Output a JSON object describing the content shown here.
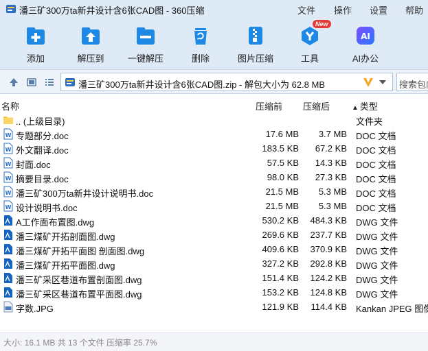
{
  "window": {
    "title": "潘三矿300万ta新井设计含6张CAD图 - 360压缩",
    "menu": [
      "文件",
      "操作",
      "设置",
      "帮助"
    ]
  },
  "toolbar": {
    "items": [
      {
        "label": "添加",
        "icon": "add-icon"
      },
      {
        "label": "解压到",
        "icon": "extract-to-icon"
      },
      {
        "label": "一键解压",
        "icon": "one-click-extract-icon"
      },
      {
        "label": "删除",
        "icon": "delete-icon"
      },
      {
        "label": "图片压缩",
        "icon": "image-compress-icon"
      },
      {
        "label": "工具",
        "icon": "tools-icon",
        "badge": "New"
      },
      {
        "label": "AI办公",
        "icon": "ai-office-icon",
        "glyph": "AI"
      }
    ]
  },
  "address": {
    "path": "潘三矿300万ta新井设计含6张CAD图.zip - 解包大小为 62.8 MB",
    "search_placeholder": "搜索包内"
  },
  "columns": {
    "name": "名称",
    "size": "压缩前",
    "packed": "压缩后",
    "type": "类型",
    "type_sort_arrow": "▲"
  },
  "files": [
    {
      "name": ".. (上级目录)",
      "size": "",
      "packed": "",
      "type": "文件夹",
      "icon": "folder"
    },
    {
      "name": "专题部分.doc",
      "size": "17.6 MB",
      "packed": "3.7 MB",
      "type": "DOC 文档",
      "icon": "doc"
    },
    {
      "name": "外文翻译.doc",
      "size": "183.5 KB",
      "packed": "67.2 KB",
      "type": "DOC 文档",
      "icon": "doc"
    },
    {
      "name": "封面.doc",
      "size": "57.5 KB",
      "packed": "14.3 KB",
      "type": "DOC 文档",
      "icon": "doc"
    },
    {
      "name": "摘要目录.doc",
      "size": "98.0 KB",
      "packed": "27.3 KB",
      "type": "DOC 文档",
      "icon": "doc"
    },
    {
      "name": "潘三矿300万ta新井设计说明书.doc",
      "size": "21.5 MB",
      "packed": "5.3 MB",
      "type": "DOC 文档",
      "icon": "doc"
    },
    {
      "name": "设计说明书.doc",
      "size": "21.5 MB",
      "packed": "5.3 MB",
      "type": "DOC 文档",
      "icon": "doc"
    },
    {
      "name": "A工作面布置图.dwg",
      "size": "530.2 KB",
      "packed": "484.3 KB",
      "type": "DWG 文件",
      "icon": "dwg"
    },
    {
      "name": "潘三煤矿开拓剖面图.dwg",
      "size": "269.6 KB",
      "packed": "237.7 KB",
      "type": "DWG 文件",
      "icon": "dwg"
    },
    {
      "name": "潘三煤矿开拓平面图 剖面图.dwg",
      "size": "409.6 KB",
      "packed": "370.9 KB",
      "type": "DWG 文件",
      "icon": "dwg"
    },
    {
      "name": "潘三煤矿开拓平面图.dwg",
      "size": "327.2 KB",
      "packed": "292.8 KB",
      "type": "DWG 文件",
      "icon": "dwg"
    },
    {
      "name": "潘三矿采区巷道布置剖面图.dwg",
      "size": "151.4 KB",
      "packed": "124.2 KB",
      "type": "DWG 文件",
      "icon": "dwg"
    },
    {
      "name": "潘三矿采区巷道布置平面图.dwg",
      "size": "153.2 KB",
      "packed": "124.8 KB",
      "type": "DWG 文件",
      "icon": "dwg"
    },
    {
      "name": "字数.JPG",
      "size": "121.9 KB",
      "packed": "114.4 KB",
      "type": "Kankan JPEG 图像",
      "icon": "jpg"
    }
  ],
  "status": {
    "text": "大小: 16.1 MB 共 13 个文件 压缩率 25.7%"
  },
  "colors": {
    "accent": "#1e88e5",
    "toolbar_bg": "#dfeaf7",
    "v_logo": "#f5a623"
  }
}
